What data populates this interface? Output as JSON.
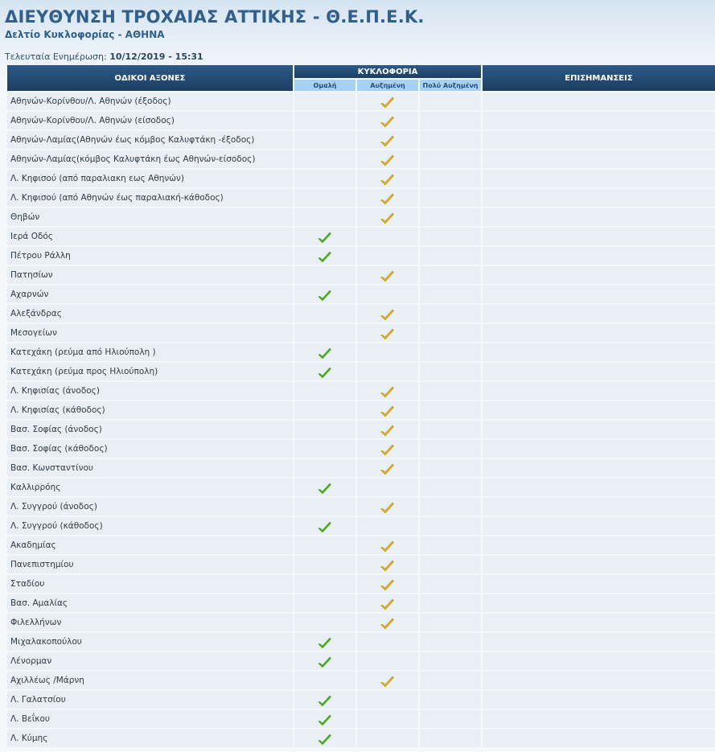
{
  "header": {
    "title": "ΔΙΕΥΘΥΝΣΗ ΤΡΟΧΑΙΑΣ ΑΤΤΙΚΗΣ - Θ.Ε.Π.Ε.Κ.",
    "subtitle": "Δελτίο Κυκλοφορίας - ΑΘΗΝΑ",
    "updated_label": "Τελευταία Ενημέρωση:",
    "updated_value": "10/12/2019 - 15:31"
  },
  "table": {
    "col_roads": "ΟΔΙΚΟΙ ΑΞΟΝΕΣ",
    "col_traffic": "ΚΥΚΛΟΦΟΡΙΑ",
    "col_notes": "ΕΠΙΣΗΜΑΝΣΕΙΣ",
    "traffic_levels": [
      "Ομαλή",
      "Αυξημένη",
      "Πολύ Αυξημένη"
    ]
  },
  "colors": {
    "normal_check": "#2fbf1a",
    "increased_check": "#f2b705",
    "header_bg": "#244c74",
    "subheader_bg": "#a6d1f6",
    "row_bg": "#e9eff5"
  },
  "icons": {
    "normal": "green-check-icon",
    "increased": "orange-check-icon"
  },
  "rows": [
    {
      "road": "Αθηνών-Κορίνθου/Λ. Αθηνών (έξοδος)",
      "level": "increased"
    },
    {
      "road": "Αθηνών-Κορίνθου/Λ. Αθηνών (είσοδος)",
      "level": "increased"
    },
    {
      "road": "Αθηνών-Λαμίας(Αθηνών έως κόμβος Καλυφτάκη -έξοδος)",
      "level": "increased"
    },
    {
      "road": "Αθηνών-Λαμίας(κόμβος Καλυφτάκη έως Αθηνών-είσοδος)",
      "level": "increased"
    },
    {
      "road": "Λ. Κηφισού (από παραλιακη εως Αθηνών)",
      "level": "increased"
    },
    {
      "road": "Λ. Κηφισού (από Αθηνών έως παραλιακή-κάθοδος)",
      "level": "increased"
    },
    {
      "road": "Θηβών",
      "level": "increased"
    },
    {
      "road": "Ιερά Οδός",
      "level": "normal"
    },
    {
      "road": "Πέτρου Ράλλη",
      "level": "normal"
    },
    {
      "road": "Πατησίων",
      "level": "increased"
    },
    {
      "road": "Αχαρνών",
      "level": "normal"
    },
    {
      "road": "Αλεξάνδρας",
      "level": "increased"
    },
    {
      "road": "Μεσογείων",
      "level": "increased"
    },
    {
      "road": "Κατεχάκη (ρεύμα από Ηλιούπολη )",
      "level": "normal"
    },
    {
      "road": "Κατεχάκη (ρεύμα προς Ηλιούπολη)",
      "level": "normal"
    },
    {
      "road": "Λ. Κηφισίας (άνοδος)",
      "level": "increased"
    },
    {
      "road": "Λ. Κηφισίας (κάθοδος)",
      "level": "increased"
    },
    {
      "road": "Βασ. Σοφίας (άνοδος)",
      "level": "increased"
    },
    {
      "road": "Βασ. Σοφίας (κάθοδος)",
      "level": "increased"
    },
    {
      "road": "Βασ. Κωνσταντίνου",
      "level": "increased"
    },
    {
      "road": "Καλλιρρόης",
      "level": "normal"
    },
    {
      "road": "Λ. Συγγρού (άνοδος)",
      "level": "increased"
    },
    {
      "road": "Λ. Συγγρού (κάθοδος)",
      "level": "normal"
    },
    {
      "road": "Ακαδημίας",
      "level": "increased"
    },
    {
      "road": "Πανεπιστημίου",
      "level": "increased"
    },
    {
      "road": "Σταδίου",
      "level": "increased"
    },
    {
      "road": "Βασ. Αμαλίας",
      "level": "increased"
    },
    {
      "road": "Φιλελλήνων",
      "level": "increased"
    },
    {
      "road": "Μιχαλακοπούλου",
      "level": "normal"
    },
    {
      "road": "Λένορμαν",
      "level": "normal"
    },
    {
      "road": "Αχιλλέως /Μάρνη",
      "level": "increased"
    },
    {
      "road": "Λ. Γαλατσίου",
      "level": "normal"
    },
    {
      "road": "Λ. Βεΐκου",
      "level": "normal"
    },
    {
      "road": "Λ. Κύμης",
      "level": "normal"
    }
  ]
}
